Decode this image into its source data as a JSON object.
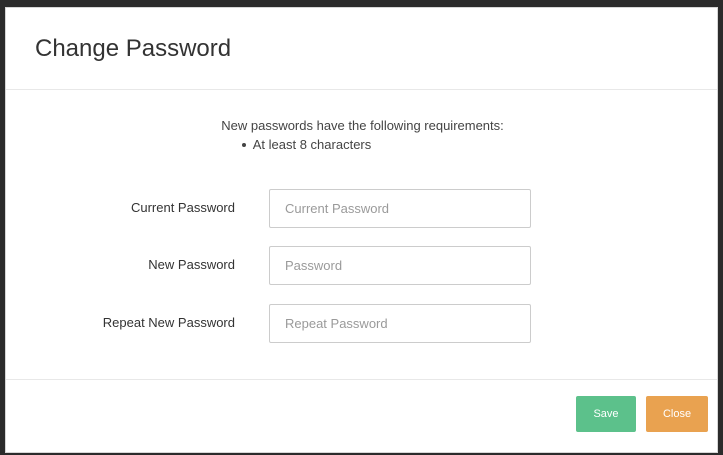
{
  "dialog": {
    "title": "Change Password"
  },
  "requirements": {
    "heading": "New passwords have the following requirements:",
    "items": [
      "At least 8 characters"
    ]
  },
  "form": {
    "current_password": {
      "label": "Current Password",
      "placeholder": "Current Password",
      "value": ""
    },
    "new_password": {
      "label": "New Password",
      "placeholder": "Password",
      "value": ""
    },
    "repeat_password": {
      "label": "Repeat New Password",
      "placeholder": "Repeat Password",
      "value": ""
    }
  },
  "footer": {
    "save_label": "Save",
    "close_label": "Close"
  },
  "colors": {
    "save_button": "#5cc18b",
    "close_button": "#e9a250"
  }
}
